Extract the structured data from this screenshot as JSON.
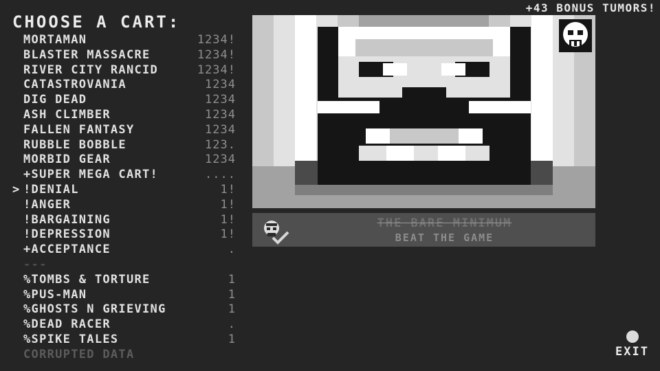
{
  "bonus_text": "+43 BONUS TUMORS!",
  "title": "CHOOSE A CART:",
  "cursor_glyph": ">",
  "carts": [
    {
      "name": "MORTAMAN",
      "score": "1234!",
      "selected": false,
      "kind": "cart"
    },
    {
      "name": "BLASTER MASSACRE",
      "score": "1234!",
      "selected": false,
      "kind": "cart"
    },
    {
      "name": "RIVER CITY RANCID",
      "score": "1234!",
      "selected": false,
      "kind": "cart"
    },
    {
      "name": "CATASTROVANIA",
      "score": "1234",
      "selected": false,
      "kind": "cart"
    },
    {
      "name": "DIG DEAD",
      "score": "1234",
      "selected": false,
      "kind": "cart"
    },
    {
      "name": "ASH CLIMBER",
      "score": "1234",
      "selected": false,
      "kind": "cart"
    },
    {
      "name": "FALLEN FANTASY",
      "score": "1234",
      "selected": false,
      "kind": "cart"
    },
    {
      "name": "RUBBLE BOBBLE",
      "score": "123.",
      "selected": false,
      "kind": "cart"
    },
    {
      "name": "MORBID GEAR",
      "score": "1234",
      "selected": false,
      "kind": "cart"
    },
    {
      "name": "+SUPER MEGA CART!",
      "score": "....",
      "selected": false,
      "kind": "cart"
    },
    {
      "name": "!DENIAL",
      "score": "1!",
      "selected": true,
      "kind": "cart"
    },
    {
      "name": "!ANGER",
      "score": "1!",
      "selected": false,
      "kind": "cart"
    },
    {
      "name": "!BARGAINING",
      "score": "1!",
      "selected": false,
      "kind": "cart"
    },
    {
      "name": "!DEPRESSION",
      "score": "1!",
      "selected": false,
      "kind": "cart"
    },
    {
      "name": "+ACCEPTANCE",
      "score": ".",
      "selected": false,
      "kind": "cart"
    },
    {
      "name": "---",
      "score": "",
      "selected": false,
      "kind": "separator"
    },
    {
      "name": "%TOMBS & TORTURE",
      "score": "1",
      "selected": false,
      "kind": "cart"
    },
    {
      "name": "%PUS-MAN",
      "score": "1",
      "selected": false,
      "kind": "cart"
    },
    {
      "name": "%GHOSTS N GRIEVING",
      "score": "1",
      "selected": false,
      "kind": "cart"
    },
    {
      "name": "%DEAD RACER",
      "score": ".",
      "selected": false,
      "kind": "cart"
    },
    {
      "name": "%SPIKE TALES",
      "score": "1",
      "selected": false,
      "kind": "cart"
    },
    {
      "name": "CORRUPTED DATA",
      "score": "",
      "selected": false,
      "kind": "corrupted"
    }
  ],
  "preview": {
    "icon": "pixel-skull-face",
    "badge_icon": "skull-icon"
  },
  "achievement": {
    "name": "THE BARE MINIMUM",
    "description": "BEAT THE GAME",
    "icon": "skull-checkmark-icon",
    "completed": true
  },
  "exit": {
    "label": "EXIT",
    "icon": "button-dot-icon"
  },
  "colors": {
    "background": "#252525",
    "text": "#e6e6e6",
    "score": "#8f8f8f",
    "disabled": "#5c5c5c",
    "achievement_bg": "#4f4f4f"
  }
}
